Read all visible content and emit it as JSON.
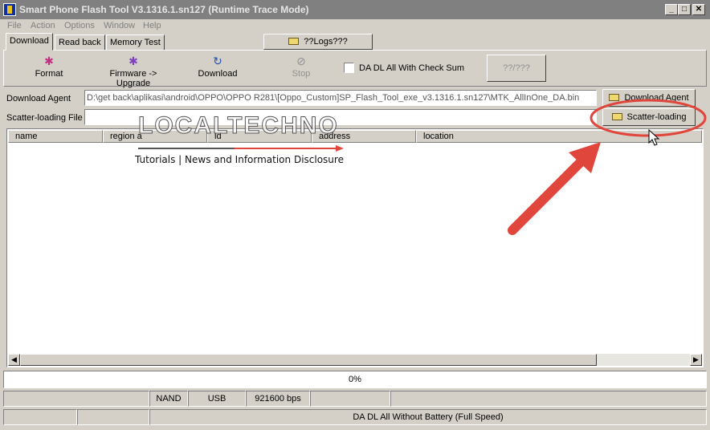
{
  "window": {
    "title": "Smart Phone Flash Tool V3.1316.1.sn127 (Runtime Trace Mode)",
    "controls": [
      "_",
      "□",
      "✕"
    ]
  },
  "menu": [
    "File",
    "Action",
    "Options",
    "Window",
    "Help"
  ],
  "tabs": [
    "Download",
    "Read back",
    "Memory Test"
  ],
  "logs_button": "??Logs???",
  "toolbar": {
    "format": "Format",
    "firmware_upgrade": "Firmware -> Upgrade",
    "download": "Download",
    "stop": "Stop",
    "checkbox_label": "DA DL All With Check Sum",
    "question_button": "??/???"
  },
  "fields": {
    "download_agent_label": "Download Agent",
    "download_agent_value": "D:\\get back\\aplikasi\\android\\OPPO\\OPPO R281\\[Oppo_Custom]SP_Flash_Tool_exe_v3.1316.1.sn127\\MTK_AllInOne_DA.bin",
    "download_agent_button": "Download Agent",
    "scatter_label": "Scatter-loading File",
    "scatter_value": "",
    "scatter_button": "Scatter-loading"
  },
  "table": {
    "columns": [
      "name",
      "region a",
      "ld",
      "address",
      "location"
    ]
  },
  "progress": {
    "text": "0%",
    "value": 0
  },
  "status": {
    "storage": "NAND",
    "connection": "USB",
    "baud": "921600 bps",
    "mode": "DA DL All Without Battery (Full Speed)"
  },
  "watermark": {
    "title": "LOCALTECHNO",
    "subtitle": "Tutorials | News and Information Disclosure"
  },
  "colors": {
    "annotation": "#e0463c",
    "titlebar": "#808080"
  }
}
